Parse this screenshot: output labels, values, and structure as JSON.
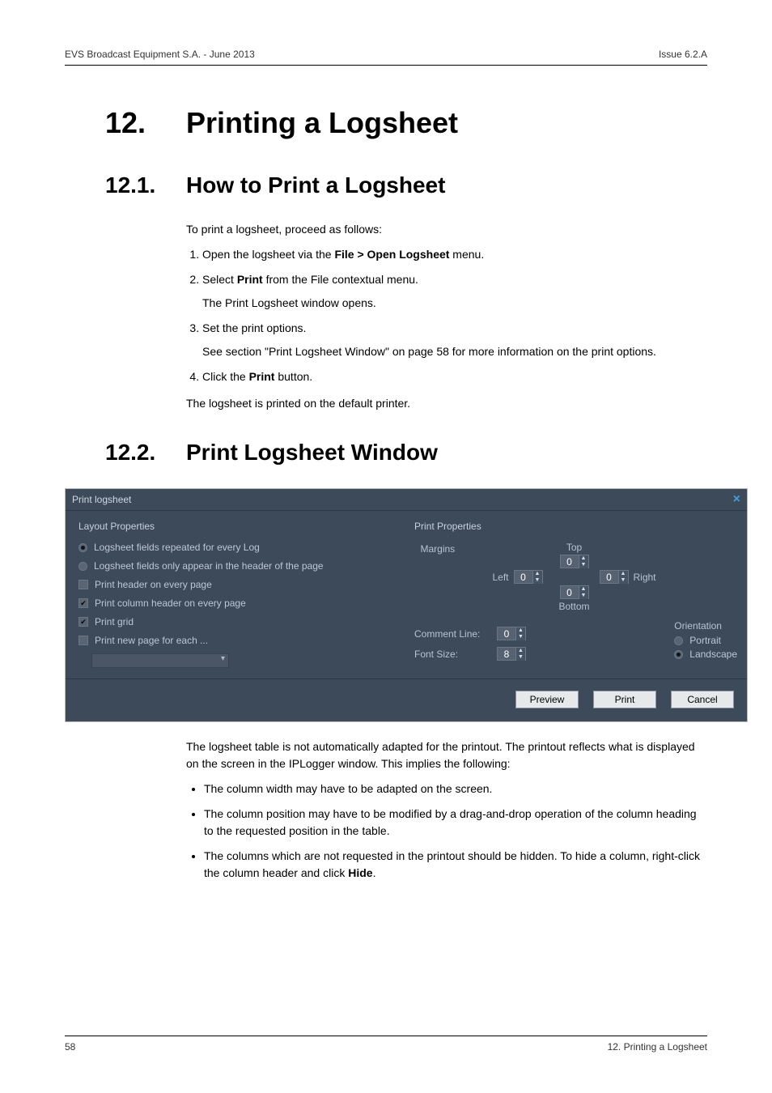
{
  "header": {
    "left": "EVS Broadcast Equipment S.A. - June 2013",
    "right": "Issue 6.2.A"
  },
  "footer": {
    "left": "58",
    "right": "12. Printing a Logsheet"
  },
  "h1": {
    "num": "12.",
    "title": "Printing a Logsheet"
  },
  "h2a": {
    "num": "12.1.",
    "title": "How to Print a Logsheet"
  },
  "intro": "To print a logsheet, proceed as follows:",
  "steps": {
    "s1a": "Open the logsheet via the ",
    "s1b": "File > Open Logsheet",
    "s1c": " menu.",
    "s2a": "Select ",
    "s2b": "Print",
    "s2c": " from the File contextual menu.",
    "s2sub": "The Print Logsheet window opens.",
    "s3": "Set the print options.",
    "s3sub": "See section \"Print Logsheet Window\" on page 58 for more information on the print options.",
    "s4a": "Click the ",
    "s4b": "Print",
    "s4c": " button."
  },
  "afterSteps": "The logsheet is printed on the default printer.",
  "h2b": {
    "num": "12.2.",
    "title": "Print Logsheet Window"
  },
  "afterDialog1": "The logsheet table is not automatically adapted for the printout. The printout reflects what is displayed on the screen in the IPLogger window. This implies the following:",
  "bullets": {
    "b1": "The column width may have to be adapted on the screen.",
    "b2": "The column position may have to be modified by a drag-and-drop operation of the column heading to the requested position in the table.",
    "b3a": "The columns which are not requested in the printout should be hidden. To hide a column, right-click the column header and click ",
    "b3b": "Hide",
    "b3c": "."
  },
  "dialog": {
    "title": "Print logsheet",
    "close": "×",
    "layout": {
      "title": "Layout Properties",
      "o1": "Logsheet fields repeated for every Log",
      "o2": "Logsheet fields only appear in the header of the page",
      "o3": "Print header on every page",
      "o4": "Print column header on every page",
      "o5": "Print grid",
      "o6": "Print new page for each ..."
    },
    "print": {
      "title": "Print Properties",
      "margins": "Margins",
      "top": "Top",
      "bottom": "Bottom",
      "left": "Left",
      "right": "Right",
      "topv": "0",
      "leftv": "0",
      "rightv": "0",
      "botv": "0",
      "commentLine": "Comment Line:",
      "commentLineV": "0",
      "fontSize": "Font Size:",
      "fontSizeV": "8",
      "orientation": "Orientation",
      "portrait": "Portrait",
      "landscape": "Landscape"
    },
    "buttons": {
      "preview": "Preview",
      "print": "Print",
      "cancel": "Cancel"
    }
  }
}
